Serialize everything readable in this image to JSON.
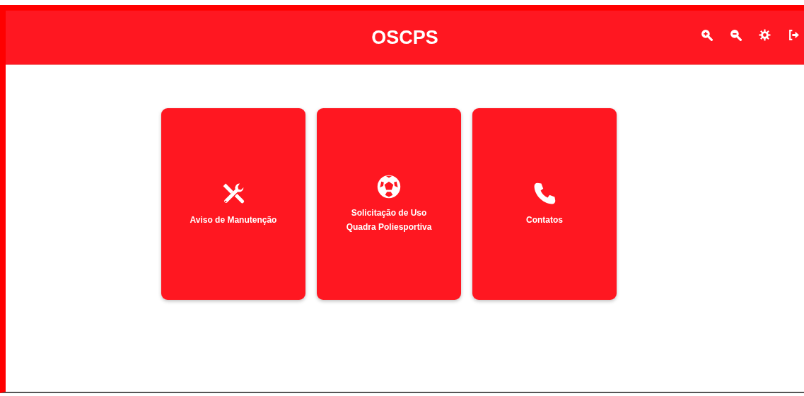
{
  "header": {
    "title": "OSCPS"
  },
  "cards": [
    {
      "kind": "tools",
      "label": "Aviso de Manutenção"
    },
    {
      "kind": "ball",
      "label": "Solicitação de Uso\nQuadra Poliesportiva"
    },
    {
      "kind": "phone",
      "label": "Contatos"
    }
  ]
}
